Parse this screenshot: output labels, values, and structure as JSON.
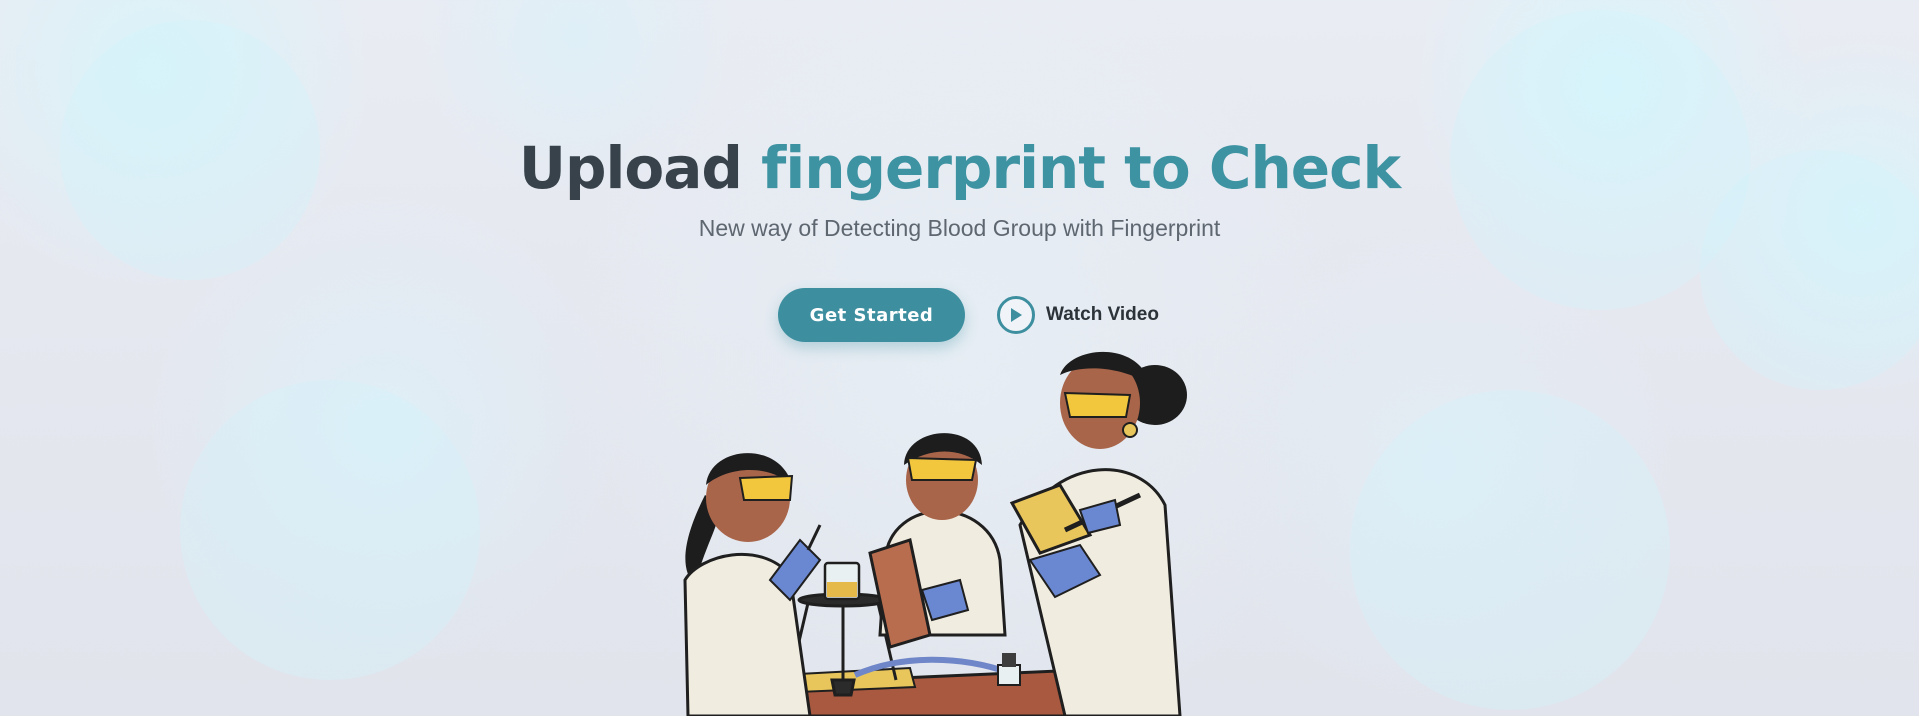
{
  "hero": {
    "title_lead": "Upload",
    "title_accent": "fingerprint to Check",
    "subtitle": "New way of Detecting Blood Group with Fingerprint"
  },
  "actions": {
    "get_started_label": "Get Started",
    "watch_video_label": "Watch Video"
  },
  "icons": {
    "play": "play-icon"
  },
  "colors": {
    "accent": "#3e93a2",
    "button": "#3d8fa0",
    "title_dark": "#37424a",
    "subtitle": "#5e6670"
  }
}
